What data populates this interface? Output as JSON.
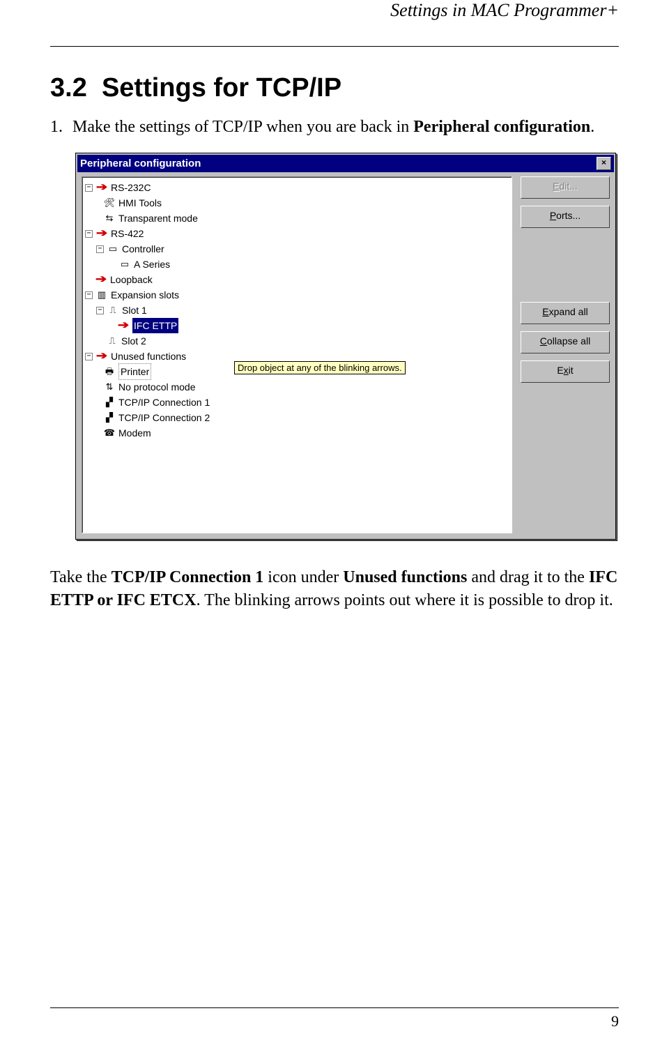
{
  "header": {
    "running_title": "Settings in MAC Programmer+"
  },
  "section": {
    "number": "3.2",
    "title": "Settings for TCP/IP"
  },
  "intro": {
    "step_number": "1.",
    "text_before_bold": "Make the settings of TCP/IP when you are back in ",
    "bold1": "Peripheral configuration",
    "after": "."
  },
  "dialog": {
    "title": "Peripheral configuration",
    "close": "×",
    "tooltip": "Drop object at any of the blinking arrows.",
    "buttons": {
      "edit": "Edit...",
      "ports": "Ports...",
      "expand": "Expand all",
      "collapse": "Collapse all",
      "exit": "Exit"
    },
    "tree": {
      "rs232c": "RS-232C",
      "hmi": "HMI Tools",
      "transparent": "Transparent mode",
      "rs422": "RS-422",
      "controller": "Controller",
      "aseries": "A Series",
      "loopback": "Loopback",
      "expansion": "Expansion slots",
      "slot1": "Slot 1",
      "ifcettp": "IFC ETTP",
      "slot2": "Slot 2",
      "unused": "Unused functions",
      "printer": "Printer",
      "noprotocol": "No protocol mode",
      "tcp1": "TCP/IP Connection 1",
      "tcp2": "TCP/IP Connection 2",
      "modem": "Modem"
    }
  },
  "caption": {
    "p1a": "Take the ",
    "b1": "TCP/IP Connection 1",
    "p1b": " icon under ",
    "b2": "Unused functions",
    "p1c": " and drag it to the ",
    "b3": "IFC ETTP or IFC ETCX",
    "p1d": ". The blinking arrows points out where it is possible to drop it."
  },
  "page_number": "9"
}
